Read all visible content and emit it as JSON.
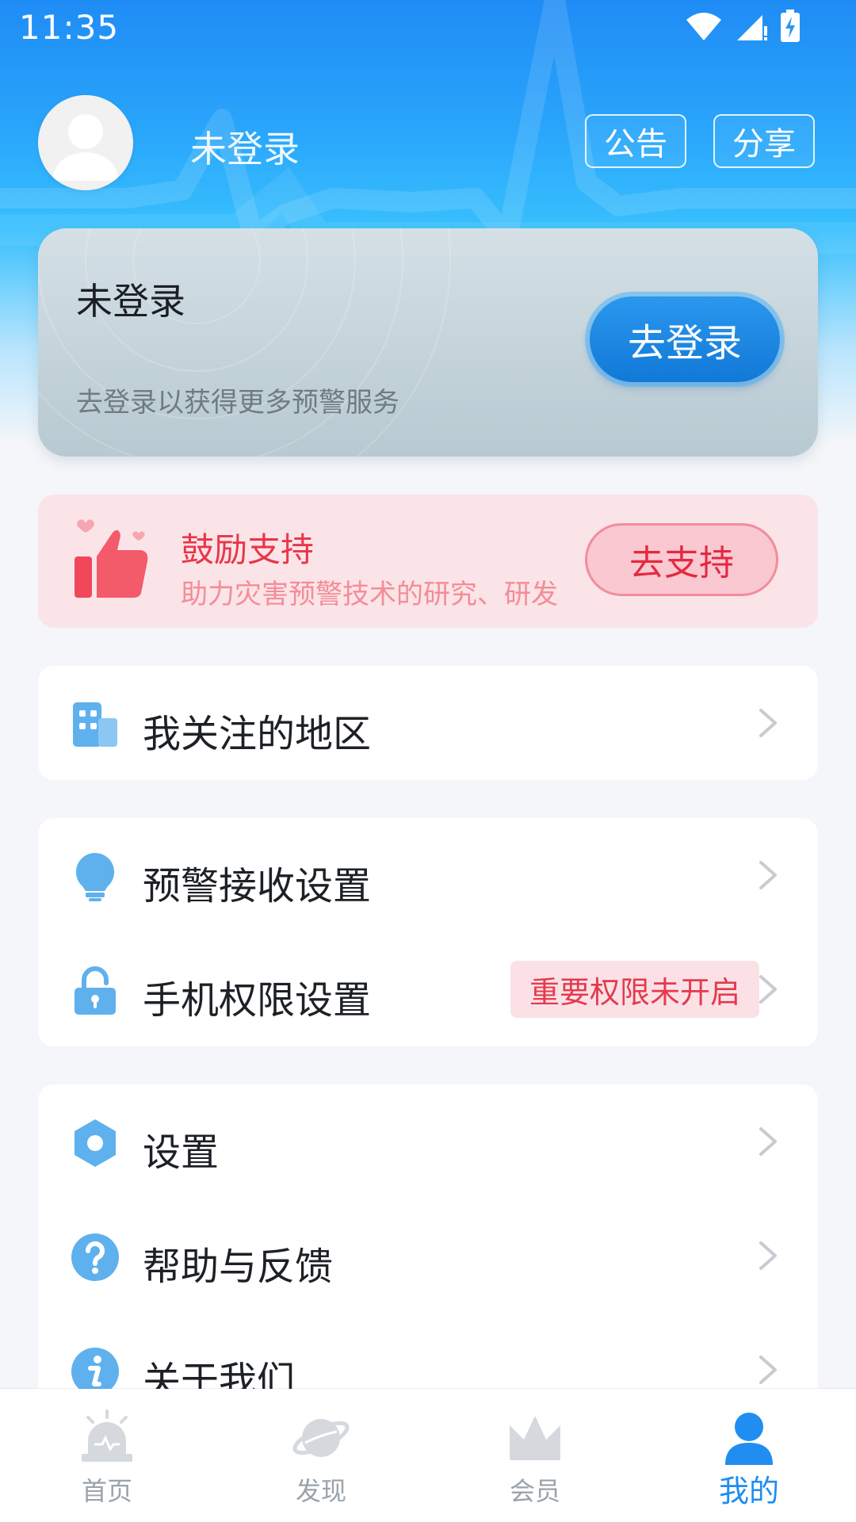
{
  "status_bar": {
    "time": "11:35"
  },
  "header": {
    "username": "未登录",
    "notice_label": "公告",
    "share_label": "分享"
  },
  "login_card": {
    "title": "未登录",
    "subtitle": "去登录以获得更多预警服务",
    "button_label": "去登录"
  },
  "support_card": {
    "title": "鼓励支持",
    "subtitle": "助力灾害预警技术的研究、研发",
    "button_label": "去支持"
  },
  "menu": {
    "regions": {
      "label": "我关注的地区",
      "icon": "building-icon"
    },
    "alert_settings": {
      "label": "预警接收设置",
      "icon": "lightbulb-icon"
    },
    "permissions": {
      "label": "手机权限设置",
      "icon": "lock-icon",
      "badge": "重要权限未开启"
    },
    "settings": {
      "label": "设置",
      "icon": "hexagon-settings-icon"
    },
    "help": {
      "label": "帮助与反馈",
      "icon": "question-icon"
    },
    "about": {
      "label": "关于我们",
      "icon": "info-icon"
    }
  },
  "bottom_nav": {
    "items": [
      {
        "label": "首页",
        "icon": "alarm-icon",
        "active": false
      },
      {
        "label": "发现",
        "icon": "planet-icon",
        "active": false
      },
      {
        "label": "会员",
        "icon": "crown-icon",
        "active": false
      },
      {
        "label": "我的",
        "icon": "person-icon",
        "active": true
      }
    ]
  },
  "colors": {
    "primary": "#1f8ef0",
    "alert_red": "#e8364a",
    "icon_blue": "#5fb1ee"
  }
}
